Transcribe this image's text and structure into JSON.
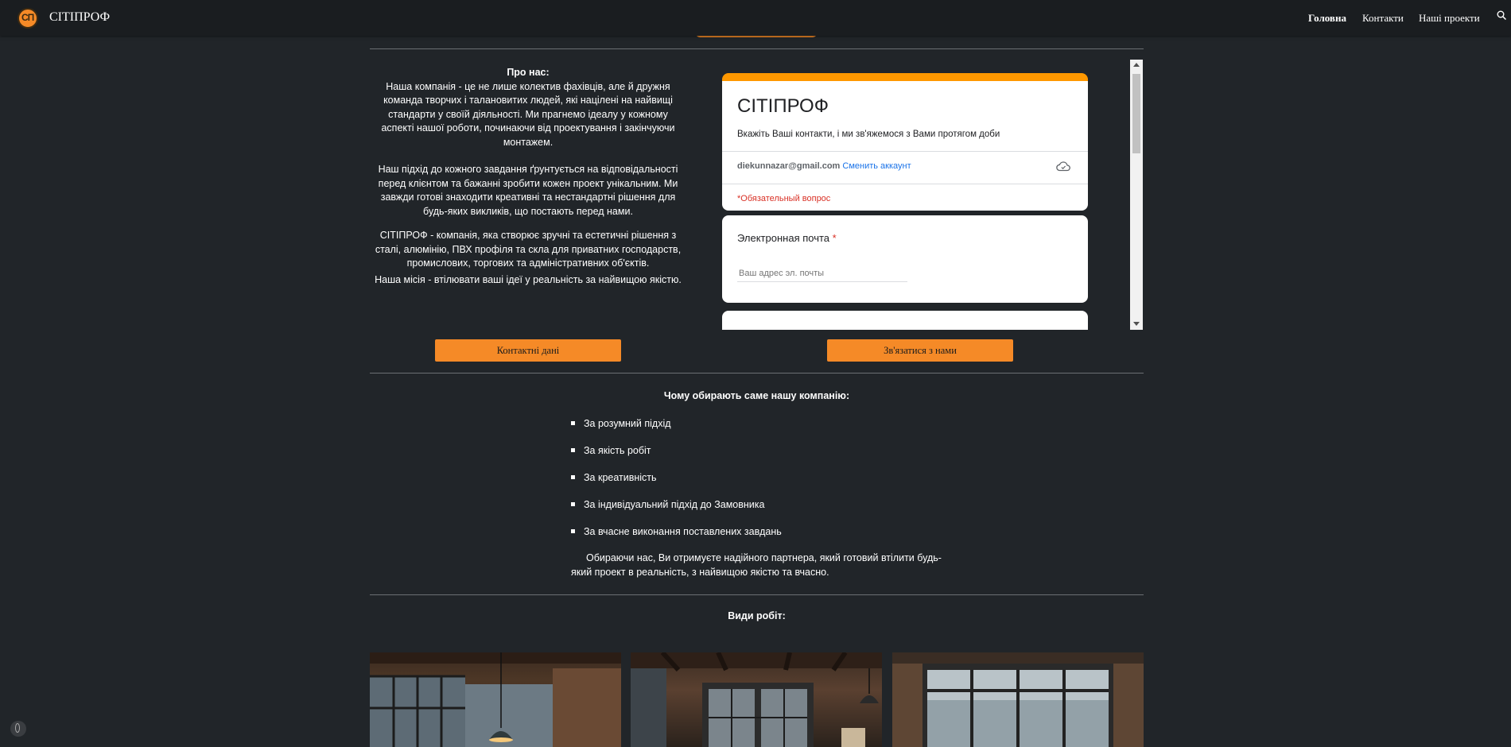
{
  "header": {
    "site_title": "СІТІПРОФ",
    "logo_text": "СП",
    "nav": [
      "Головна",
      "Контакти",
      "Наші проекти"
    ],
    "active_nav": "Головна"
  },
  "about": {
    "title": "Про нас:",
    "p1": "Наша компанія - це не лише колектив фахівців, але й дружня команда творчих і талановитих людей, які націлені на найвищі стандарти у своїй діяльності. Ми прагнемо ідеалу у кожному аспекті нашої роботи, починаючи від проектування і закінчуючи монтажем.",
    "p2": "Наш підхід до кожного завдання ґрунтується на відповідальності перед клієнтом та бажанні зробити кожен проект унікальним. Ми завжди готові знаходити креативні та нестандартні рішення для будь-яких викликів, що постають перед нами.",
    "p3": "СІТІПРОФ - компанія, яка створює зручні та естетичні рішення з сталі, алюмінію, ПВХ профіля та скла для приватних господарств, промислових, торгових та адміністративних об'єктів.",
    "p4": "Наша місія - втілювати ваші ідеї у реальність за найвищою якістю."
  },
  "form": {
    "title": "СІТІПРОФ",
    "description": "Вкажіть Ваші контакти, і ми зв'яжемося з Вами протягом доби",
    "account_email": "diekunnazar@gmail.com",
    "switch_account": "Сменить аккаунт",
    "required_note": "*Обязательный вопрос",
    "question_label": "Электронная почта",
    "required_star": "*",
    "email_placeholder": "Ваш адрес эл. почты"
  },
  "buttons": {
    "contacts": "Контактні дані",
    "contact_us": "Зв'язатися з нами"
  },
  "why": {
    "title": "Чому обирають саме нашу компанію:",
    "items": [
      "За розумний підхід",
      "За якість робіт",
      "За креативність",
      "За індивідуальний підхід до Замовника",
      "За вчасне виконання поставлених завдань"
    ],
    "summary": "Обираючи нас, Ви отримуєте надійного партнера, який готовий втілити будь-який проект в реальність, з найвищою якістю та вчасно."
  },
  "works": {
    "title": "Види робіт:"
  },
  "colors": {
    "accent": "#f58a27",
    "background": "#212529",
    "form_header": "#ff9800"
  }
}
